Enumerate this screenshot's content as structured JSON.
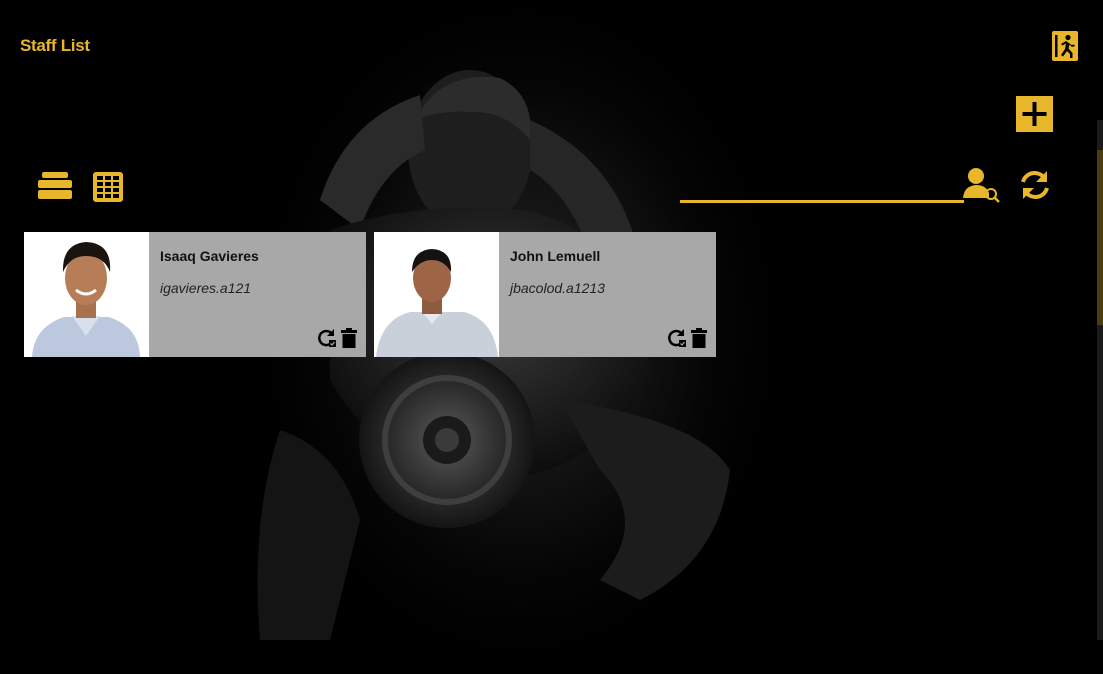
{
  "header": {
    "title": "Staff List"
  },
  "toolbar": {
    "exit_icon": "exit-running-man-icon",
    "add_icon": "plus-icon",
    "list_view_icon": "list-view-icon",
    "grid_view_icon": "grid-view-icon",
    "refresh_icon": "refresh-icon",
    "user_search_icon": "user-search-icon"
  },
  "search": {
    "value": "",
    "placeholder": ""
  },
  "staff": [
    {
      "name": "Isaaq Gavieres",
      "username": "igavieres.a121"
    },
    {
      "name": "John Lemuell",
      "username": "jbacolod.a1213"
    }
  ],
  "colors": {
    "accent": "#e8b62a",
    "background": "#000000",
    "card": "#a8a8a8"
  }
}
